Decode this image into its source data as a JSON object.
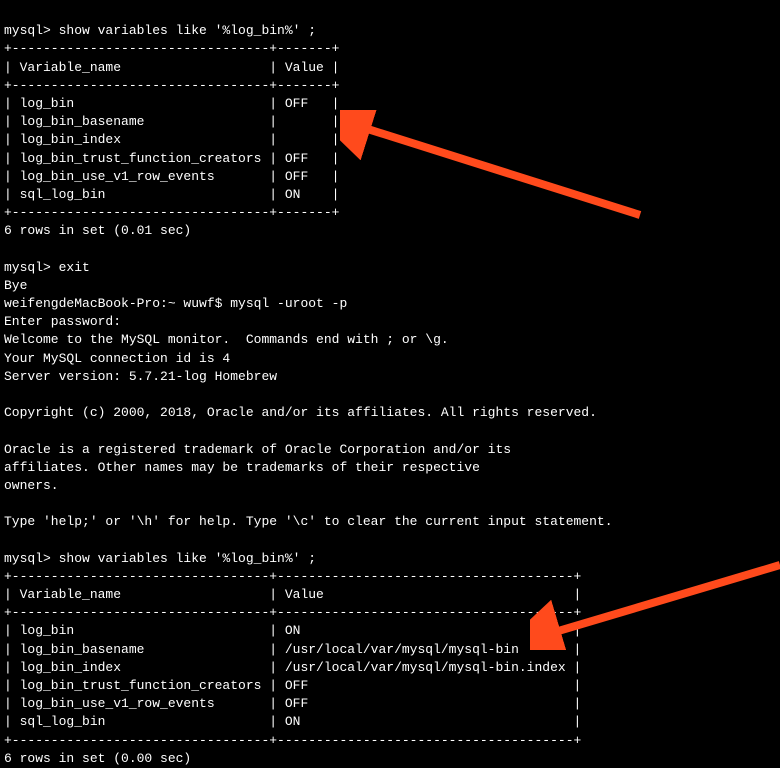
{
  "terminal": {
    "line1": "mysql> show variables like '%log_bin%' ;",
    "table1": {
      "border": "+---------------------------------+-------+",
      "header": "| Variable_name                   | Value |",
      "rows": [
        "| log_bin                         | OFF   |",
        "| log_bin_basename                |       |",
        "| log_bin_index                   |       |",
        "| log_bin_trust_function_creators | OFF   |",
        "| log_bin_use_v1_row_events       | OFF   |",
        "| sql_log_bin                     | ON    |"
      ],
      "summary": "6 rows in set (0.01 sec)"
    },
    "exit1": "mysql> exit",
    "bye": "Bye",
    "shell_prompt": "weifengdeMacBook-Pro:~ wuwf$ mysql -uroot -p",
    "enter_pw": "Enter password:",
    "welcome1": "Welcome to the MySQL monitor.  Commands end with ; or \\g.",
    "conn_id": "Your MySQL connection id is 4",
    "server_ver": "Server version: 5.7.21-log Homebrew",
    "copyright": "Copyright (c) 2000, 2018, Oracle and/or its affiliates. All rights reserved.",
    "oracle1": "Oracle is a registered trademark of Oracle Corporation and/or its",
    "oracle2": "affiliates. Other names may be trademarks of their respective",
    "oracle3": "owners.",
    "help": "Type 'help;' or '\\h' for help. Type '\\c' to clear the current input statement.",
    "line2": "mysql> show variables like '%log_bin%' ;",
    "table2": {
      "border": "+---------------------------------+--------------------------------------+",
      "header": "| Variable_name                   | Value                                |",
      "rows": [
        "| log_bin                         | ON                                   |",
        "| log_bin_basename                | /usr/local/var/mysql/mysql-bin       |",
        "| log_bin_index                   | /usr/local/var/mysql/mysql-bin.index |",
        "| log_bin_trust_function_creators | OFF                                  |",
        "| log_bin_use_v1_row_events       | OFF                                  |",
        "| sql_log_bin                     | ON                                   |"
      ],
      "summary": "6 rows in set (0.00 sec)"
    }
  }
}
